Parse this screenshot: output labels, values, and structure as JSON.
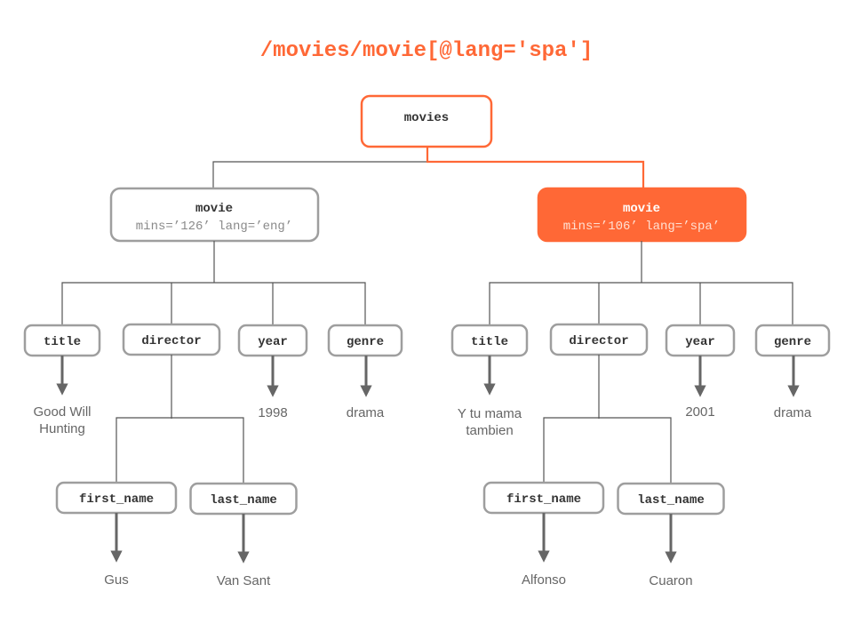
{
  "query": "/movies/movie[@lang='spa']",
  "colors": {
    "highlight": "#ff6836",
    "node_border": "#9e9e9e",
    "edge": "#555555",
    "leaf_text": "#666666"
  },
  "root": {
    "label": "movies"
  },
  "movies": [
    {
      "label": "movie",
      "attrs": "mins=’126’ lang=’eng’",
      "selected": false,
      "children": {
        "title": {
          "label": "title",
          "value": [
            "Good Will",
            "Hunting"
          ]
        },
        "director": {
          "label": "director",
          "first_name": {
            "label": "first_name",
            "value": "Gus"
          },
          "last_name": {
            "label": "last_name",
            "value": "Van Sant"
          }
        },
        "year": {
          "label": "year",
          "value": "1998"
        },
        "genre": {
          "label": "genre",
          "value": "drama"
        }
      }
    },
    {
      "label": "movie",
      "attrs": "mins=’106’ lang=’spa’",
      "selected": true,
      "children": {
        "title": {
          "label": "title",
          "value": [
            "Y tu mama",
            "tambien"
          ]
        },
        "director": {
          "label": "director",
          "first_name": {
            "label": "first_name",
            "value": "Alfonso"
          },
          "last_name": {
            "label": "last_name",
            "value": "Cuaron"
          }
        },
        "year": {
          "label": "year",
          "value": "2001"
        },
        "genre": {
          "label": "genre",
          "value": "drama"
        }
      }
    }
  ]
}
